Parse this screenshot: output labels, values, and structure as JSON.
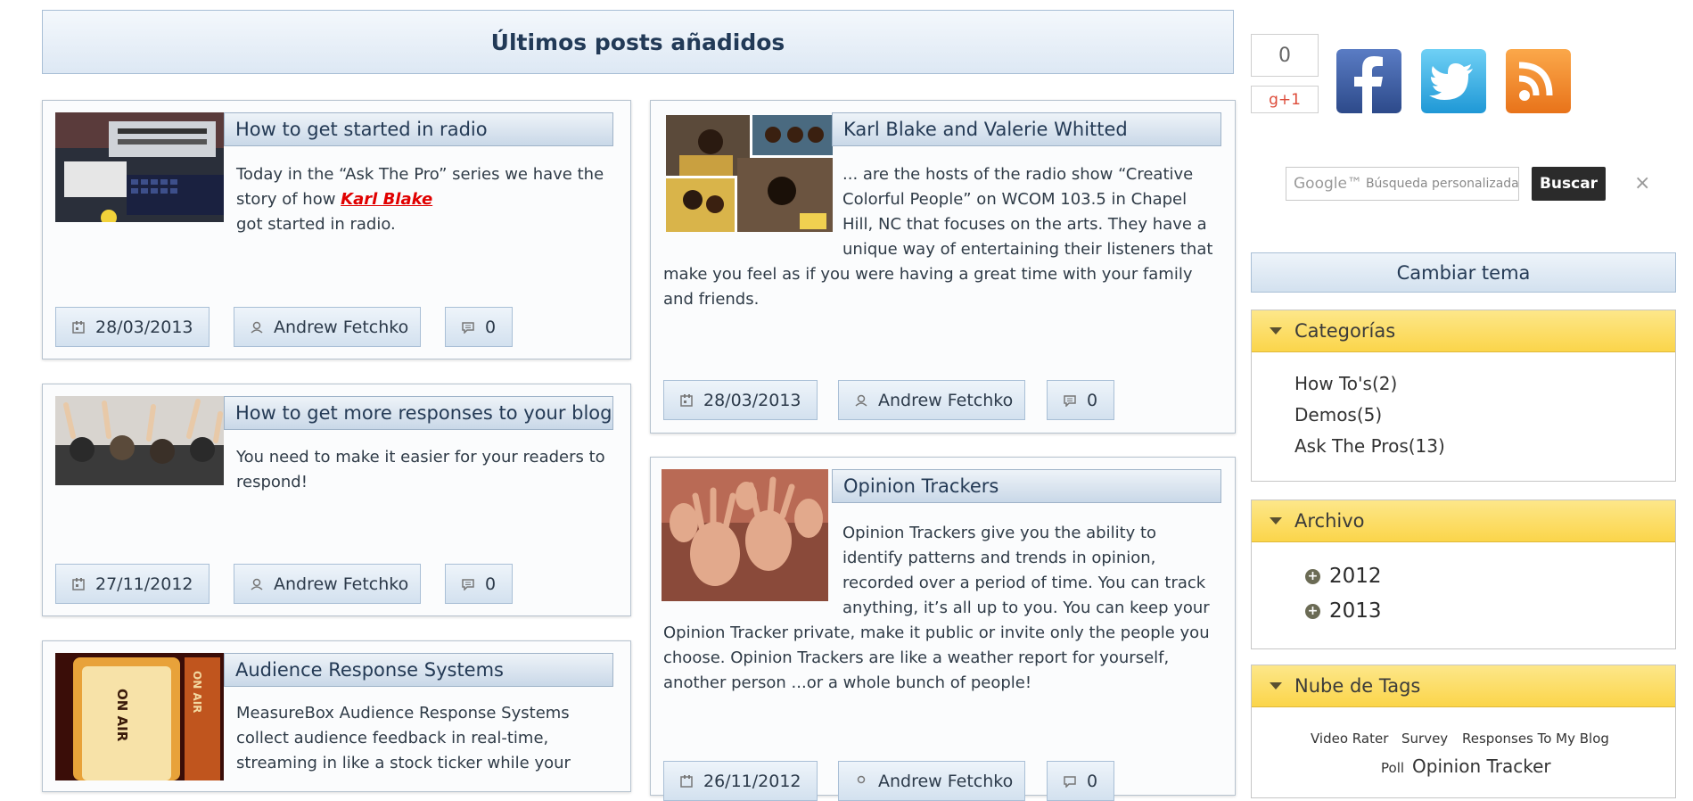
{
  "header": {
    "title": "Últimos posts añadidos"
  },
  "posts": [
    {
      "title": "How to get started in radio",
      "excerpt_before": "Today in the “Ask The Pro” series we have the story of how ",
      "excerpt_link": "Karl Blake",
      "excerpt_after": " got started in radio.",
      "date": "28/03/2013",
      "author": "Andrew Fetchko",
      "comments": "0"
    },
    {
      "title": "How to get more responses to your blog",
      "excerpt": "You need to make it easier for your readers to respond!",
      "date": "27/11/2012",
      "author": "Andrew Fetchko",
      "comments": "0"
    },
    {
      "title": "Audience Response Systems",
      "excerpt": "MeasureBox Audience Response Systems collect audience feedback in real-time, streaming in like a stock ticker while your"
    },
    {
      "title": "Karl Blake and Valerie Whitted",
      "excerpt_line1": "... are the hosts of the radio show “Creative",
      "excerpt_line2": "Colorful People” on WCOM 103.5 in Chapel",
      "excerpt_line3": "Hill, NC that focuses on the arts. They have a",
      "excerpt_line4": "unique way of entertaining their listeners that",
      "excerpt_rest": "make you feel as if you were having a great time with your family and friends.",
      "date": "28/03/2013",
      "author": "Andrew Fetchko",
      "comments": "0"
    },
    {
      "title": "Opinion Trackers",
      "excerpt_line1": "Opinion Trackers give you the ability to",
      "excerpt_line2": "identify patterns and trends in opinion,",
      "excerpt_line3": "recorded over a period of time. You can track",
      "excerpt_line4": "anything, it’s all up to you. You can keep your",
      "excerpt_rest": "Opinion Tracker private, make it public or invite only the people you choose. Opinion Trackers are like a weather report for yourself, another person ...or a whole bunch of people!",
      "date": "26/11/2012",
      "author": "Andrew Fetchko",
      "comments": "0"
    }
  ],
  "sidebar": {
    "share_count": "0",
    "gplus_label": "g+1",
    "social": [
      "facebook-icon",
      "twitter-icon",
      "rss-icon"
    ],
    "search": {
      "placeholder": "Búsqueda personalizada",
      "google_label": "Google™",
      "button": "Buscar",
      "close": "×"
    },
    "theme_button": "Cambiar tema",
    "categories": {
      "title": "Categorías",
      "items": [
        {
          "name": "How To's",
          "count": "(2)"
        },
        {
          "name": "Demos",
          "count": "(5)"
        },
        {
          "name": "Ask The Pros",
          "count": "(13)"
        }
      ]
    },
    "archive": {
      "title": "Archivo",
      "years": [
        "2012",
        "2013"
      ]
    },
    "tags": {
      "title": "Nube de Tags",
      "items": [
        "Video Rater",
        "Survey",
        "Responses To My Blog",
        "Poll",
        "Opinion Tracker"
      ]
    }
  },
  "colors": {
    "accent_link": "#e00000",
    "widget_header": "#fbd54a",
    "header_bar": "#dde8f4"
  }
}
